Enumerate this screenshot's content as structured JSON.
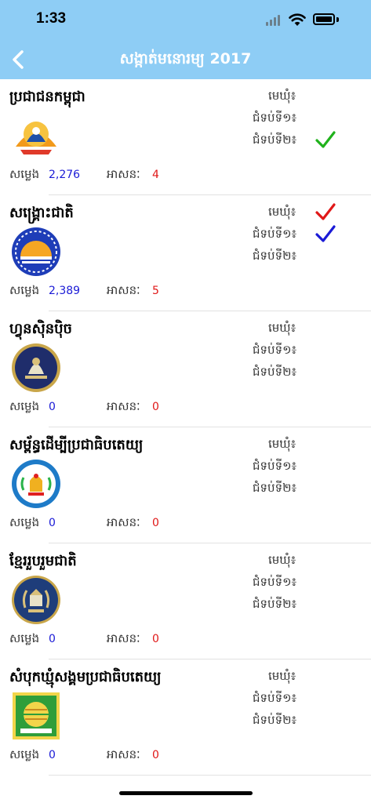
{
  "status_bar": {
    "time": "1:33"
  },
  "header": {
    "title": "សង្កាត់មនោរម្យ 2017",
    "back": "back"
  },
  "labels": {
    "votes": "សម្លេង",
    "seats": "អាសនៈ",
    "round_commune": "មេឃុំ៖",
    "round_deputy1": "ជំទប់ទី១៖",
    "round_deputy2": "ជំទប់ទី២៖"
  },
  "colors": {
    "header_bg": "#8ecdf5",
    "votes": "#1a1ad6",
    "seats": "#e01818",
    "check_green": "#20b21c",
    "check_red": "#e01818",
    "check_blue": "#1a1ad6"
  },
  "parties": [
    {
      "name": "ប្រជាជនកម្ពុជា",
      "votes": "2,276",
      "seats": "4",
      "logo": "cpp-logo",
      "checks": [
        "",
        "",
        "green"
      ]
    },
    {
      "name": "សង្គ្រោះជាតិ",
      "votes": "2,389",
      "seats": "5",
      "logo": "cnrp-logo",
      "checks": [
        "red",
        "blue",
        ""
      ]
    },
    {
      "name": "ហ្វុនស៊ិនប៉ិច",
      "votes": "0",
      "seats": "0",
      "logo": "funcinpec-logo",
      "checks": [
        "",
        "",
        ""
      ]
    },
    {
      "name": "សម្ព័ន្ធដើម្បីប្រជាធិបតេយ្យ",
      "votes": "0",
      "seats": "0",
      "logo": "ldp-logo",
      "checks": [
        "",
        "",
        ""
      ]
    },
    {
      "name": "ខ្មែររួបរួមជាតិ",
      "votes": "0",
      "seats": "0",
      "logo": "knup-logo",
      "checks": [
        "",
        "",
        ""
      ]
    },
    {
      "name": "សំបុកឃ្មុំសង្គមប្រជាធិបតេយ្យ",
      "votes": "0",
      "seats": "0",
      "logo": "beehive-logo",
      "checks": [
        "",
        "",
        ""
      ]
    }
  ]
}
